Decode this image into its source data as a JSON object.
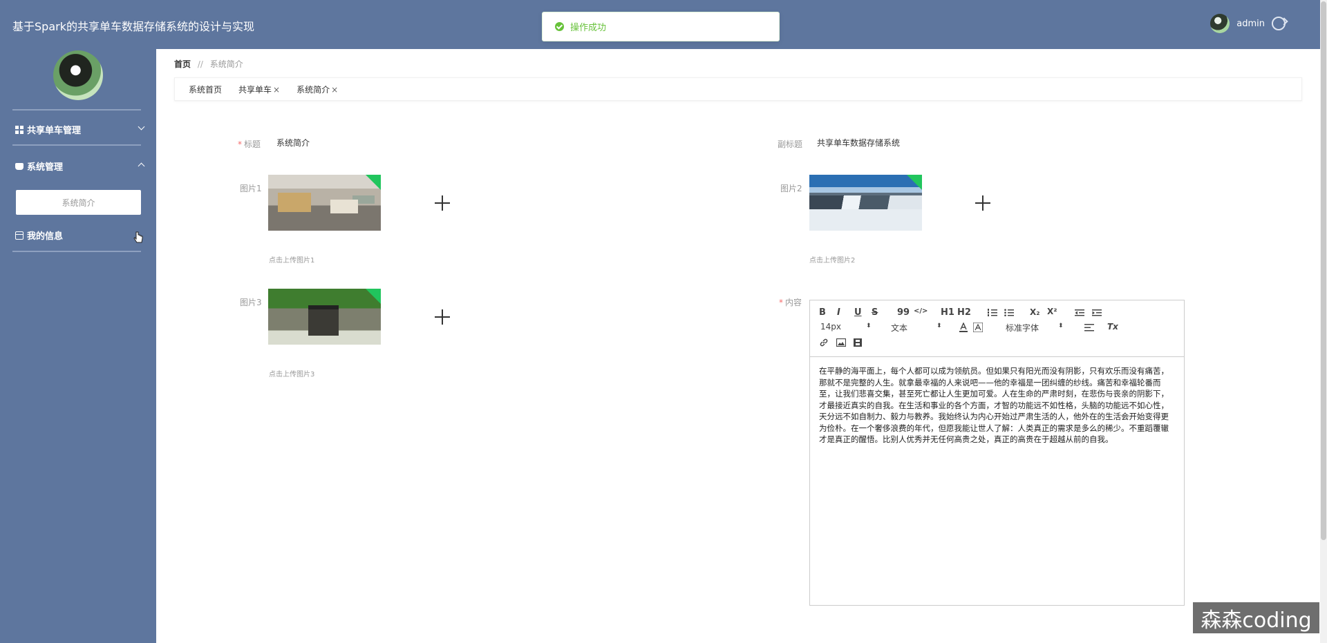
{
  "header": {
    "title": "基于Spark的共享单车数据存储系统的设计与实现",
    "username": "admin"
  },
  "toast": {
    "message": "操作成功"
  },
  "sidebar": {
    "items": [
      {
        "label": "共享单车管理"
      },
      {
        "label": "系统管理",
        "submenu": [
          "系统简介"
        ]
      },
      {
        "label": "我的信息"
      }
    ]
  },
  "breadcrumb": {
    "home": "首页",
    "separator": "//",
    "current": "系统简介"
  },
  "tabs": [
    {
      "label": "系统首页",
      "close": ""
    },
    {
      "label": "共享单车",
      "close": "×"
    },
    {
      "label": "系统简介",
      "close": "×"
    }
  ],
  "form": {
    "title_label": "标题",
    "title_value": "系统简介",
    "subtitle_label": "副标题",
    "subtitle_value": "共享单车数据存储系统",
    "image1_label": "图片1",
    "image1_hint": "点击上传图片1",
    "image2_label": "图片2",
    "image2_hint": "点击上传图片2",
    "image3_label": "图片3",
    "image3_hint": "点击上传图片3",
    "content_label": "内容"
  },
  "editor": {
    "font_size": "14px",
    "block_format": "文本",
    "font_family": "标准字体",
    "buttons": {
      "bold": "B",
      "italic": "I",
      "underline": "U",
      "strike": "S",
      "quote": "99",
      "code": "</>",
      "h1": "H1",
      "h2": "H2",
      "subscript": "X₂",
      "superscript": "X²",
      "clear": "Tx"
    },
    "content": "在平静的海平面上，每个人都可以成为领航员。但如果只有阳光而没有阴影，只有欢乐而没有痛苦，那就不是完整的人生。就拿最幸福的人来说吧——他的幸福是一团纠缠的纱线。痛苦和幸福轮番而至，让我们悲喜交集，甚至死亡都让人生更加可爱。人在生命的严肃时刻，在悲伤与丧亲的阴影下，才最接近真实的自我。在生活和事业的各个方面，才智的功能远不如性格，头脑的功能远不如心性，天分远不如自制力、毅力与教养。我始终认为内心开始过严肃生活的人，他外在的生活会开始变得更为俭朴。在一个奢侈浪费的年代，但愿我能让世人了解：人类真正的需求是多么的稀少。不重蹈覆辙才是真正的醒悟。比别人优秀并无任何高贵之处，真正的高贵在于超越从前的自我。"
  },
  "watermark": "森森coding",
  "colors": {
    "header_bg": "#5e769e",
    "sidebar_bg": "#5e769e",
    "success": "#67c23a",
    "required": "#f56c6c"
  }
}
